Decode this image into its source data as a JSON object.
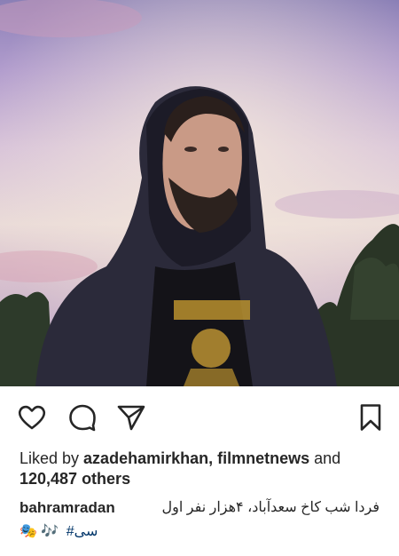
{
  "post": {
    "image_alt": "photo",
    "likes": {
      "prefix": "Liked by ",
      "users": "azadehamirkhan, filmnetnews",
      "and": " and",
      "count": "120,487 others"
    },
    "caption": {
      "username": "bahramradan",
      "text": "فردا شب کاخ سعدآباد، ۴هزار نفر اول",
      "emojis": "🎭 🎶",
      "hashtag": "#سی"
    }
  },
  "icons": {
    "like": "heart-icon",
    "comment": "comment-bubble-icon",
    "share": "paper-plane-icon",
    "save": "bookmark-icon"
  },
  "colors": {
    "text": "#262626",
    "hashtag": "#003569",
    "background": "#ffffff"
  }
}
